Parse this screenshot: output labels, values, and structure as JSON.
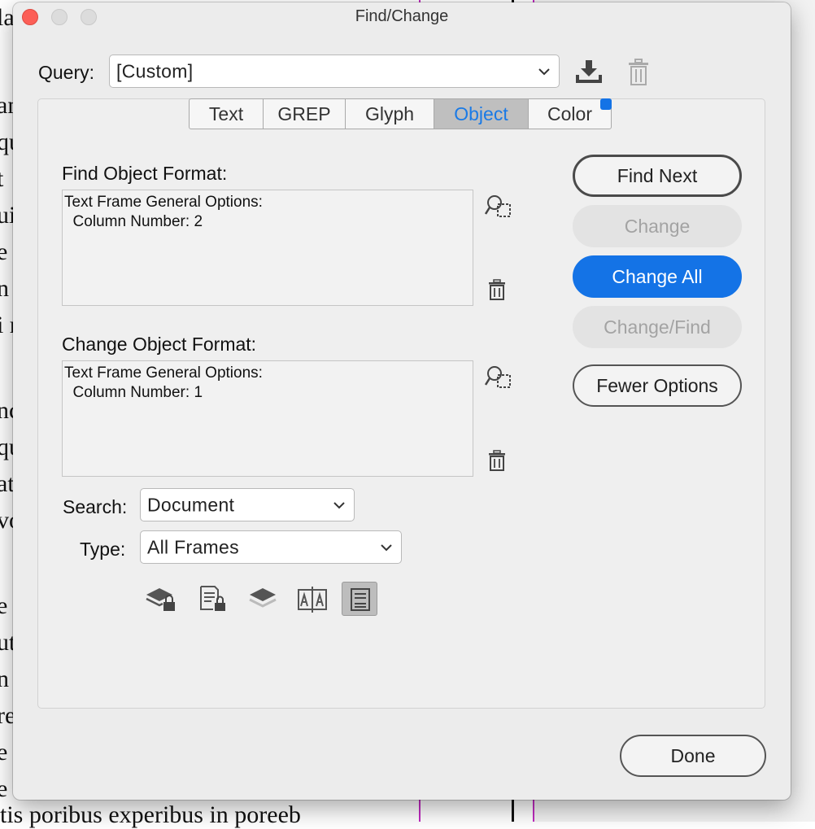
{
  "background_document": {
    "lines": [
      "la",
      "an",
      "qu",
      "t",
      "ui",
      "e",
      "n",
      "i r",
      "nc",
      "qu",
      "at",
      "vo",
      "e",
      "ut",
      "n",
      "re",
      "e",
      "e",
      "tis poribus experibus in poreeb"
    ]
  },
  "window": {
    "title": "Find/Change",
    "query": {
      "label": "Query:",
      "value": "[Custom]"
    },
    "tabs": [
      {
        "label": "Text"
      },
      {
        "label": "GREP"
      },
      {
        "label": "Glyph"
      },
      {
        "label": "Object",
        "active": true
      },
      {
        "label": "Color"
      }
    ],
    "find_format": {
      "label": "Find Object Format:",
      "text": "Text Frame General Options:\n  Column Number: 2"
    },
    "change_format": {
      "label": "Change Object Format:",
      "text": "Text Frame General Options:\n  Column Number: 1"
    },
    "search": {
      "label": "Search:",
      "value": "Document"
    },
    "type": {
      "label": "Type:",
      "value": "All Frames"
    },
    "buttons": {
      "find_next": "Find Next",
      "change": "Change",
      "change_all": "Change All",
      "change_find": "Change/Find",
      "fewer_options": "Fewer Options",
      "done": "Done"
    },
    "toolbar_icons": [
      "include-locked-layers-icon",
      "include-locked-objects-icon",
      "include-hidden-layers-icon",
      "include-master-pages-icon",
      "include-footnotes-icon"
    ],
    "colors": {
      "accent": "#1473e6",
      "close": "#fc5f57",
      "margin_guide": "#c12bc1"
    }
  }
}
